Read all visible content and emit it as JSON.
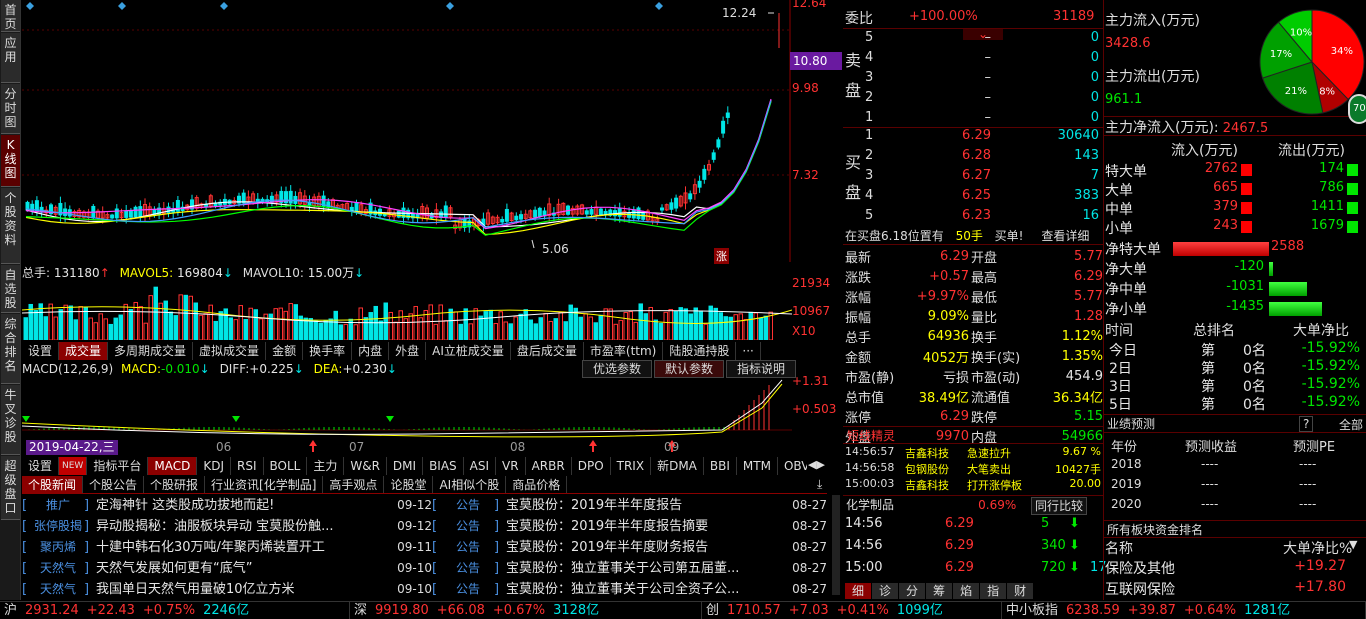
{
  "left_tabs": [
    {
      "label": "首页"
    },
    {
      "label": "应用"
    },
    {
      "label": "分时图"
    },
    {
      "label": "K线图",
      "active": true
    },
    {
      "label": "个股资料"
    },
    {
      "label": "自选股"
    },
    {
      "label": "综合排名"
    },
    {
      "label": "牛叉诊股"
    },
    {
      "label": "超级盘口"
    }
  ],
  "kchart": {
    "price_labels": [
      "12.64",
      "10.80",
      "9.98",
      "7.32"
    ],
    "highlight_price": "10.80",
    "peak_label": "12.24",
    "low_label": "5.06",
    "zhang_badge": "涨"
  },
  "volume": {
    "legend_total_label": "总手:",
    "legend_total_value": "131180",
    "ma5_label": "MAVOL5:",
    "ma5_value": "169804",
    "ma10_label": "MAVOL10:",
    "ma10_value": "15.00万",
    "axis_top": "21934",
    "axis_mid": "10967",
    "axis_unit": "X10"
  },
  "volume_tabs": [
    "设置",
    "成交量",
    "多周期成交量",
    "虚拟成交量",
    "金额",
    "换手率",
    "内盘",
    "外盘",
    "AI立桩成交量",
    "盘后成交量",
    "市盈率(ttm)",
    "陆股通持股",
    "···"
  ],
  "volume_tab_active": 1,
  "macd": {
    "title": "MACD(12,26,9)",
    "macd_label": "MACD:",
    "macd_value": "-0.010",
    "diff_label": "DIFF:",
    "diff_value": "+0.225",
    "dea_label": "DEA:",
    "dea_value": "+0.230",
    "axis_top": "+1.31",
    "axis_mid": "+0.503",
    "buttons": [
      "优选参数",
      "默认参数",
      "指标说明"
    ],
    "date_badge": "2019-04-22,三",
    "months": [
      "06",
      "07",
      "08",
      "09"
    ]
  },
  "indicator_tabs": [
    "设置",
    "NEW",
    "指标平台",
    "MACD",
    "KDJ",
    "RSI",
    "BOLL",
    "主力",
    "W&R",
    "DMI",
    "BIAS",
    "ASI",
    "VR",
    "ARBR",
    "DPO",
    "TRIX",
    "新DMA",
    "BBI",
    "MTM",
    "OBV"
  ],
  "news_tabs": [
    "个股新闻",
    "个股公告",
    "个股研报",
    "行业资讯[化学制品]",
    "高手观点",
    "论股堂",
    "AI相似个股",
    "商品价格"
  ],
  "news_left": [
    {
      "tag": "推广",
      "title": "定海神针 这类股成功拔地而起!",
      "date": "09-12"
    },
    {
      "tag": "张停股揭",
      "title": "异动股揭秘：油服板块异动 宝莫股份触...",
      "date": "09-12"
    },
    {
      "tag": "聚丙烯",
      "title": "十建中韩石化30万吨/年聚丙烯装置开工",
      "date": "09-11"
    },
    {
      "tag": "天然气",
      "title": "天然气发展如何更有“底气”",
      "date": "09-10"
    },
    {
      "tag": "天然气",
      "title": "我国单日天然气用量破10亿立方米",
      "date": "09-10"
    }
  ],
  "news_right": [
    {
      "tag": "公告",
      "title": "宝莫股份：2019年半年度报告",
      "date": "08-27"
    },
    {
      "tag": "公告",
      "title": "宝莫股份：2019年半年度报告摘要",
      "date": "08-27"
    },
    {
      "tag": "公告",
      "title": "宝莫股份：2019年半年度财务报告",
      "date": "08-27"
    },
    {
      "tag": "公告",
      "title": "宝莫股份：独立董事关于公司第五届董...",
      "date": "08-27"
    },
    {
      "tag": "公告",
      "title": "宝莫股份：独立董事关于公司全资子公...",
      "date": "08-27"
    }
  ],
  "order_book": {
    "weibi_label": "委比",
    "weibi_value": "+100.00%",
    "weicha_value": "31189",
    "sell_label": "卖盘",
    "buy_label": "买盘",
    "sell": [
      {
        "n": "5",
        "p": "–",
        "v": "0"
      },
      {
        "n": "4",
        "p": "–",
        "v": "0"
      },
      {
        "n": "3",
        "p": "–",
        "v": "0"
      },
      {
        "n": "2",
        "p": "–",
        "v": "0"
      },
      {
        "n": "1",
        "p": "–",
        "v": "0"
      }
    ],
    "buy": [
      {
        "n": "1",
        "p": "6.29",
        "v": "30640"
      },
      {
        "n": "2",
        "p": "6.28",
        "v": "143"
      },
      {
        "n": "3",
        "p": "6.27",
        "v": "7"
      },
      {
        "n": "4",
        "p": "6.25",
        "v": "383"
      },
      {
        "n": "5",
        "p": "6.23",
        "v": "16"
      }
    ],
    "position_text": "在买盘6.18位置有",
    "position_qty": "50手",
    "position_action": "买单!",
    "detail_link": "查看详细"
  },
  "quote": [
    {
      "l1": "最新",
      "v1": "6.29",
      "c1": "red",
      "l2": "开盘",
      "v2": "5.77",
      "c2": "red"
    },
    {
      "l1": "涨跌",
      "v1": "+0.57",
      "c1": "red",
      "l2": "最高",
      "v2": "6.29",
      "c2": "red"
    },
    {
      "l1": "涨幅",
      "v1": "+9.97%",
      "c1": "red",
      "l2": "最低",
      "v2": "5.77",
      "c2": "red"
    },
    {
      "l1": "振幅",
      "v1": "9.09%",
      "c1": "yellow",
      "l2": "量比",
      "v2": "1.28",
      "c2": "red"
    },
    {
      "l1": "总手",
      "v1": "64936",
      "c1": "yellow",
      "l2": "换手",
      "v2": "1.12%",
      "c2": "yellow"
    },
    {
      "l1": "金额",
      "v1": "4052万",
      "c1": "yellow",
      "l2": "换手(实)",
      "v2": "1.35%",
      "c2": "yellow"
    },
    {
      "l1": "市盈(静)",
      "v1": "亏损",
      "c1": "white",
      "l2": "市盈(动)",
      "v2": "454.9",
      "c2": "white"
    },
    {
      "l1": "总市值",
      "v1": "38.49亿",
      "c1": "yellow",
      "l2": "流通值",
      "v2": "36.34亿",
      "c2": "yellow"
    },
    {
      "l1": "涨停",
      "v1": "6.29",
      "c1": "red",
      "l2": "跌停",
      "v2": "5.15",
      "c2": "green"
    },
    {
      "l1": "外盘",
      "v1": "9970",
      "c1": "red",
      "l2": "内盘",
      "v2": "54966",
      "c2": "green"
    }
  ],
  "short_wizard": {
    "title": "短线精灵",
    "rows": [
      {
        "time": "14:56:57",
        "name": "吉鑫科技",
        "event": "急速拉升",
        "value": "9.67 %"
      },
      {
        "time": "14:56:58",
        "name": "包钢股份",
        "event": "大笔卖出",
        "value": "10427手"
      },
      {
        "time": "15:00:03",
        "name": "吉鑫科技",
        "event": "打开涨停板",
        "value": "20.00"
      }
    ]
  },
  "industry": {
    "name": "化学制品",
    "change": "0.69%",
    "compare_btn": "同行比较"
  },
  "ticks": [
    {
      "time": "14:56",
      "price": "6.29",
      "vol": "5",
      "dir": "down"
    },
    {
      "time": "14:56",
      "price": "6.29",
      "vol": "340",
      "dir": "down"
    },
    {
      "time": "15:00",
      "price": "6.29",
      "vol": "720",
      "dir": "down",
      "extra": "17"
    }
  ],
  "bottom_tabs": [
    "细",
    "诊",
    "分",
    "筹",
    "焰",
    "指",
    "财"
  ],
  "capital": {
    "inflow_label": "主力流入(万元)",
    "inflow_value": "3428.6",
    "outflow_label": "主力流出(万元)",
    "outflow_value": "961.1",
    "net_label": "主力净流入(万元):",
    "net_value": "2467.5",
    "pie": [
      {
        "pct": "34%",
        "color": "#ff0000"
      },
      {
        "pct": "8%",
        "color": "#b00000"
      },
      {
        "pct": "21%",
        "color": "#008000"
      },
      {
        "pct": "17%",
        "color": "#00a000"
      },
      {
        "pct": "10%",
        "color": "#00cc00"
      }
    ],
    "pie_extra": "70",
    "headers": [
      "流入(万元)",
      "流出(万元)"
    ],
    "rows": [
      {
        "label": "特大单",
        "in": "2762",
        "out": "174"
      },
      {
        "label": "大单",
        "in": "665",
        "out": "786"
      },
      {
        "label": "中单",
        "in": "379",
        "out": "1411"
      },
      {
        "label": "小单",
        "in": "243",
        "out": "1679"
      }
    ],
    "net_rows": [
      {
        "label": "净特大单",
        "value": "2588",
        "sign": "pos",
        "frac": 1.0
      },
      {
        "label": "净大单",
        "value": "-120",
        "sign": "neg",
        "frac": 0.046
      },
      {
        "label": "净中单",
        "value": "-1031",
        "sign": "neg",
        "frac": 0.4
      },
      {
        "label": "净小单",
        "value": "-1435",
        "sign": "neg",
        "frac": 0.55
      }
    ]
  },
  "rank": {
    "headers": [
      "时间",
      "总排名",
      "大单净比"
    ],
    "rows": [
      {
        "t": "今日",
        "rank": "第",
        "n": "0名",
        "pct": "-15.92%"
      },
      {
        "t": "2日",
        "rank": "第",
        "n": "0名",
        "pct": "-15.92%"
      },
      {
        "t": "3日",
        "rank": "第",
        "n": "0名",
        "pct": "-15.92%"
      },
      {
        "t": "5日",
        "rank": "第",
        "n": "0名",
        "pct": "-15.92%"
      }
    ]
  },
  "forecast": {
    "title": "业绩预测",
    "help": "?",
    "all": "全部",
    "headers": [
      "年份",
      "预测收益",
      "预测PE"
    ],
    "rows": [
      {
        "y": "2018",
        "e": "----",
        "pe": "----"
      },
      {
        "y": "2019",
        "e": "----",
        "pe": "----"
      },
      {
        "y": "2020",
        "e": "----",
        "pe": "----"
      }
    ]
  },
  "sector": {
    "title": "所有板块资金排名",
    "headers": [
      "名称",
      "大单净比%"
    ],
    "rows": [
      {
        "name": "保险及其他",
        "value": "+19.27"
      },
      {
        "name": "互联网保险",
        "value": "+17.80"
      }
    ]
  },
  "status": [
    {
      "name": "沪",
      "idx": "2931.24",
      "chg": "+22.43",
      "pct": "+0.75%",
      "amt": "2246亿"
    },
    {
      "name": "深",
      "idx": "9919.80",
      "chg": "+66.08",
      "pct": "+0.67%",
      "amt": "3128亿"
    },
    {
      "name": "创",
      "idx": "1710.57",
      "chg": "+7.03",
      "pct": "+0.41%",
      "amt": "1099亿"
    },
    {
      "name": "中小板指",
      "idx": "6238.59",
      "chg": "+39.87",
      "pct": "+0.64%",
      "amt": "1281亿"
    }
  ]
}
